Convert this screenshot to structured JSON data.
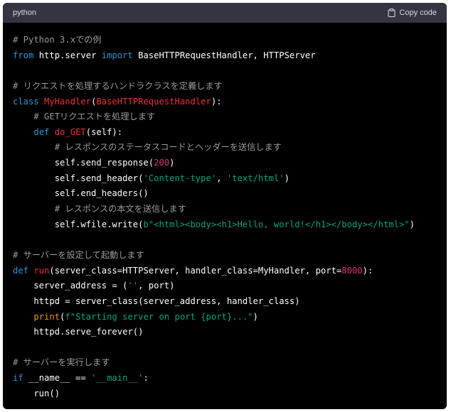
{
  "header": {
    "language": "python",
    "copy_label": "Copy code",
    "copy_icon": "clipboard-icon"
  },
  "colors": {
    "background": "#000000",
    "header_background": "#343541",
    "comment": "#9a9a9a",
    "keyword": "#2e95d3",
    "class_name": "#f22c3d",
    "string": "#00a67d",
    "number": "#df3079",
    "builtin": "#e9950c",
    "plain": "#ffffff"
  },
  "code": [
    [
      {
        "t": "# Python 3.xでの例",
        "c": "comment"
      }
    ],
    [
      {
        "t": "from",
        "c": "keyword"
      },
      {
        "t": " http.server ",
        "c": "plain"
      },
      {
        "t": "import",
        "c": "keyword"
      },
      {
        "t": " BaseHTTPRequestHandler, HTTPServer",
        "c": "plain"
      }
    ],
    [],
    [
      {
        "t": "# リクエストを処理するハンドラクラスを定義します",
        "c": "comment"
      }
    ],
    [
      {
        "t": "class",
        "c": "keyword"
      },
      {
        "t": " ",
        "c": "plain"
      },
      {
        "t": "MyHandler",
        "c": "class"
      },
      {
        "t": "(",
        "c": "plain"
      },
      {
        "t": "BaseHTTPRequestHandler",
        "c": "class"
      },
      {
        "t": "):",
        "c": "plain"
      }
    ],
    [
      {
        "t": "    ",
        "c": "plain"
      },
      {
        "t": "# GETリクエストを処理します",
        "c": "comment"
      }
    ],
    [
      {
        "t": "    ",
        "c": "plain"
      },
      {
        "t": "def",
        "c": "keyword"
      },
      {
        "t": " ",
        "c": "plain"
      },
      {
        "t": "do_GET",
        "c": "class"
      },
      {
        "t": "(self):",
        "c": "plain"
      }
    ],
    [
      {
        "t": "        ",
        "c": "plain"
      },
      {
        "t": "# レスポンスのステータスコードとヘッダーを送信します",
        "c": "comment"
      }
    ],
    [
      {
        "t": "        self.send_response(",
        "c": "plain"
      },
      {
        "t": "200",
        "c": "number"
      },
      {
        "t": ")",
        "c": "plain"
      }
    ],
    [
      {
        "t": "        self.send_header(",
        "c": "plain"
      },
      {
        "t": "'Content-type'",
        "c": "string"
      },
      {
        "t": ", ",
        "c": "plain"
      },
      {
        "t": "'text/html'",
        "c": "string"
      },
      {
        "t": ")",
        "c": "plain"
      }
    ],
    [
      {
        "t": "        self.end_headers()",
        "c": "plain"
      }
    ],
    [
      {
        "t": "        ",
        "c": "plain"
      },
      {
        "t": "# レスポンスの本文を送信します",
        "c": "comment"
      }
    ],
    [
      {
        "t": "        self.wfile.write(",
        "c": "plain"
      },
      {
        "t": "b\"<html><body><h1>Hello, world!</h1></body></html>\"",
        "c": "string"
      },
      {
        "t": ")",
        "c": "plain"
      }
    ],
    [],
    [
      {
        "t": "# サーバーを設定して起動します",
        "c": "comment"
      }
    ],
    [
      {
        "t": "def",
        "c": "keyword"
      },
      {
        "t": " ",
        "c": "plain"
      },
      {
        "t": "run",
        "c": "class"
      },
      {
        "t": "(server_class=HTTPServer, handler_class=MyHandler, port=",
        "c": "plain"
      },
      {
        "t": "8000",
        "c": "number"
      },
      {
        "t": "):",
        "c": "plain"
      }
    ],
    [
      {
        "t": "    server_address = (",
        "c": "plain"
      },
      {
        "t": "''",
        "c": "string"
      },
      {
        "t": ", port)",
        "c": "plain"
      }
    ],
    [
      {
        "t": "    httpd = server_class(server_address, handler_class)",
        "c": "plain"
      }
    ],
    [
      {
        "t": "    ",
        "c": "plain"
      },
      {
        "t": "print",
        "c": "builtin"
      },
      {
        "t": "(",
        "c": "plain"
      },
      {
        "t": "f\"Starting server on port {port}...\"",
        "c": "string"
      },
      {
        "t": ")",
        "c": "plain"
      }
    ],
    [
      {
        "t": "    httpd.serve_forever()",
        "c": "plain"
      }
    ],
    [],
    [
      {
        "t": "# サーバーを実行します",
        "c": "comment"
      }
    ],
    [
      {
        "t": "if",
        "c": "keyword"
      },
      {
        "t": " __name__ == ",
        "c": "plain"
      },
      {
        "t": "'__main__'",
        "c": "string"
      },
      {
        "t": ":",
        "c": "plain"
      }
    ],
    [
      {
        "t": "    run()",
        "c": "plain"
      }
    ]
  ]
}
